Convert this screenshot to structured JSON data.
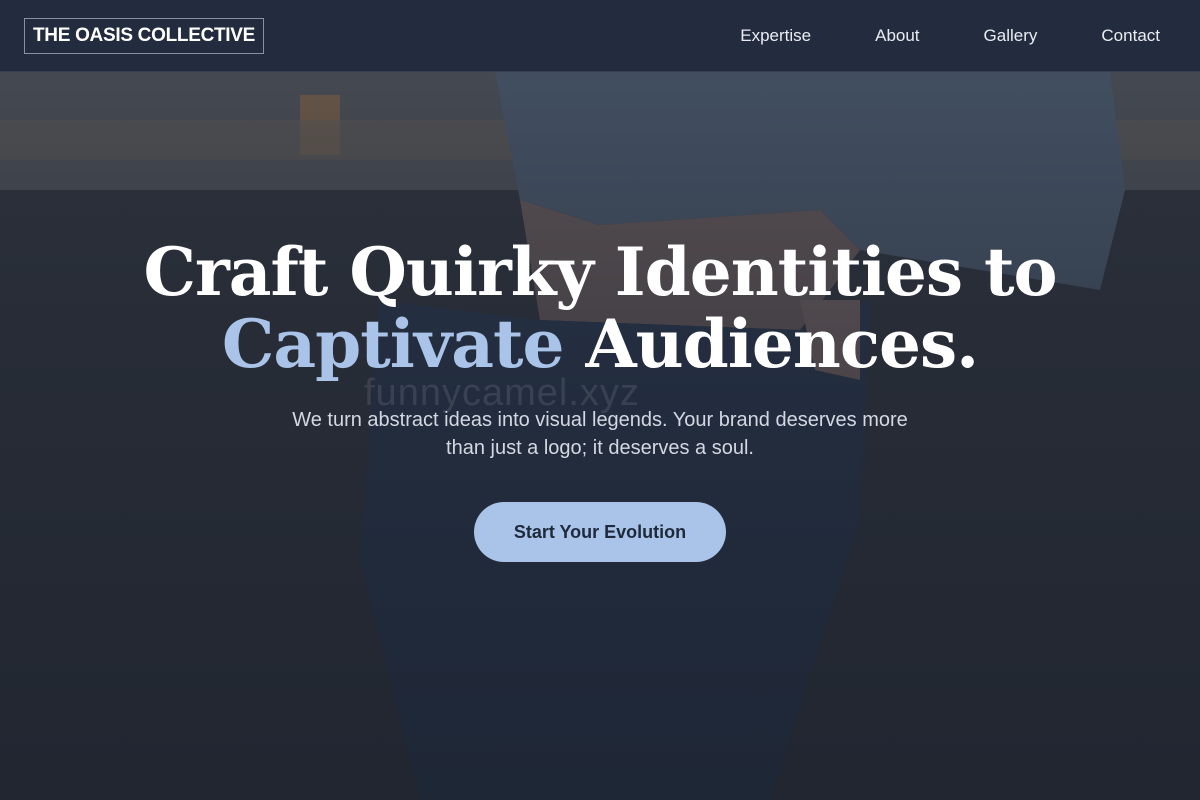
{
  "site": {
    "logo": "THE OASIS COLLECTIVE"
  },
  "nav": {
    "items": [
      {
        "label": "Expertise"
      },
      {
        "label": "About"
      },
      {
        "label": "Gallery"
      },
      {
        "label": "Contact"
      }
    ]
  },
  "hero": {
    "headline_part1": "Craft Quirky Identities to",
    "headline_accent": "Captivate",
    "headline_part2": "Audiences.",
    "subline_line1": "We turn abstract ideas into visual legends. Your brand deserves more",
    "subline_line2": "than just a logo; it deserves a soul.",
    "cta_label": "Start Your Evolution",
    "watermark": "funnycamel.xyz"
  },
  "colors": {
    "accent": "#a9c4e8",
    "nav_background": "#242c3e",
    "overlay": "#1c212e",
    "headline": "#ffffff"
  }
}
